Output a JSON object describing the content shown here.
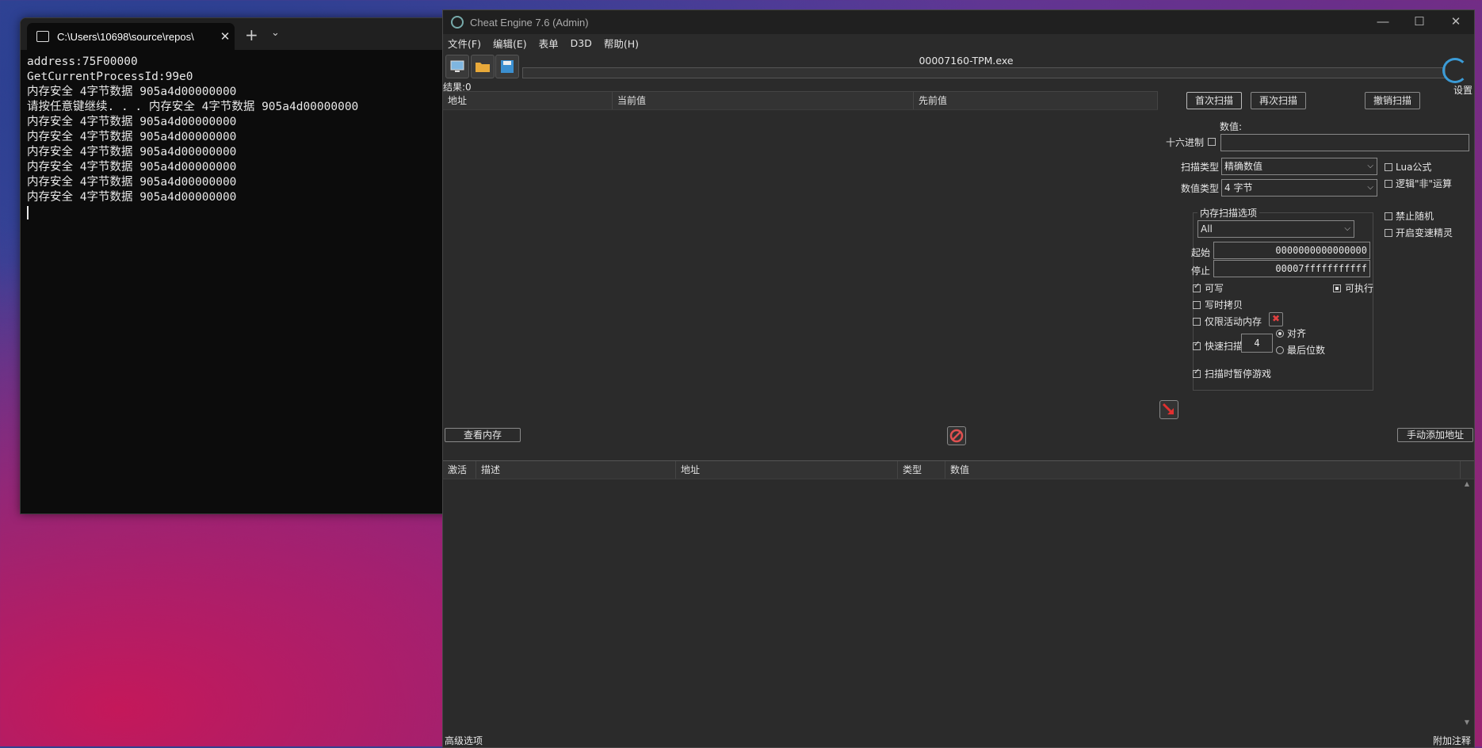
{
  "terminal": {
    "tab_title": "C:\\Users\\10698\\source\\repos\\",
    "lines": [
      "address:75F00000",
      "GetCurrentProcessId:99e0",
      "内存安全 4字节数据 905a4d00000000",
      "请按任意键继续. . . 内存安全 4字节数据 905a4d00000000",
      "内存安全 4字节数据 905a4d00000000",
      "内存安全 4字节数据 905a4d00000000",
      "内存安全 4字节数据 905a4d00000000",
      "内存安全 4字节数据 905a4d00000000",
      "内存安全 4字节数据 905a4d00000000",
      "内存安全 4字节数据 905a4d00000000"
    ]
  },
  "ce": {
    "title": "Cheat Engine 7.6 (Admin)",
    "menu": [
      "文件(F)",
      "编辑(E)",
      "表单",
      "D3D",
      "帮助(H)"
    ],
    "process": "00007160-TPM.exe",
    "settings": "设置",
    "results": "结果:0",
    "found_columns": [
      "地址",
      "当前值",
      "先前值"
    ],
    "first_scan": "首次扫描",
    "next_scan": "再次扫描",
    "undo_scan": "撤销扫描",
    "value_label": "数值:",
    "hex_label": "十六进制",
    "scan_type_label": "扫描类型",
    "scan_type_value": "精确数值",
    "value_type_label": "数值类型",
    "value_type_value": "4 字节",
    "lua_formula": "Lua公式",
    "logical_not": "逻辑\"非\"运算",
    "disable_random": "禁止随机",
    "speedhack": "开启变速精灵",
    "mem_options_title": "内存扫描选项",
    "region_value": "All",
    "start_label": "起始",
    "start_value": "0000000000000000",
    "stop_label": "停止",
    "stop_value": "00007fffffffffff",
    "writable": "可写",
    "executable": "可执行",
    "copy_on_write": "写时拷贝",
    "active_memory_only": "仅限活动内存",
    "fast_scan": "快速扫描",
    "fast_scan_value": "4",
    "alignment": "对齐",
    "last_digits": "最后位数",
    "pause_game": "扫描时暂停游戏",
    "view_memory": "查看内存",
    "add_address": "手动添加地址",
    "addr_columns": [
      "激活",
      "描述",
      "地址",
      "类型",
      "数值"
    ],
    "advanced_options": "高级选项",
    "table_extras": "附加注释"
  }
}
